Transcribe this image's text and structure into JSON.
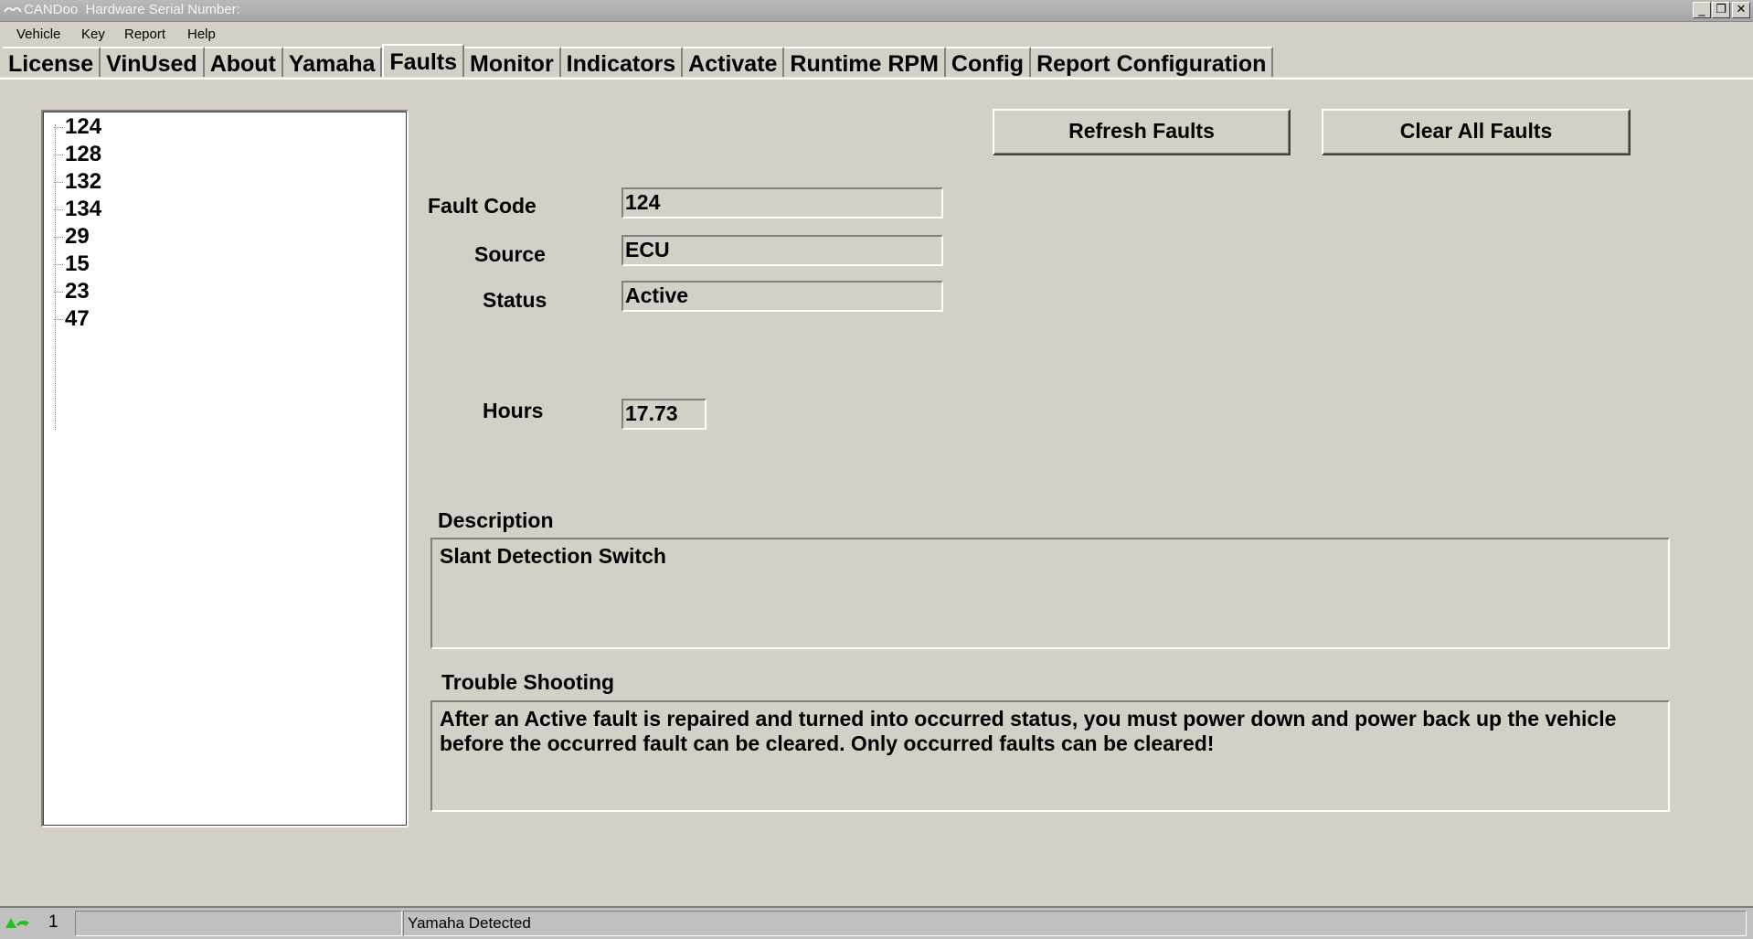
{
  "window": {
    "title": "CANDoo  Hardware Serial Number:",
    "minimize_glyph": "_",
    "restore_glyph": "❐",
    "close_glyph": "✕"
  },
  "menu": [
    "Vehicle",
    "Key",
    "Report",
    "Help"
  ],
  "tabs": [
    {
      "label": "License",
      "active": false
    },
    {
      "label": "VinUsed",
      "active": false
    },
    {
      "label": "About",
      "active": false
    },
    {
      "label": "Yamaha",
      "active": false
    },
    {
      "label": "Faults",
      "active": true
    },
    {
      "label": "Monitor",
      "active": false
    },
    {
      "label": "Indicators",
      "active": false
    },
    {
      "label": "Activate",
      "active": false
    },
    {
      "label": "Runtime RPM",
      "active": false
    },
    {
      "label": "Config",
      "active": false
    },
    {
      "label": "Report Configuration",
      "active": false
    }
  ],
  "fault_list": [
    "124",
    "128",
    "132",
    "134",
    "29",
    "15",
    "23",
    "47"
  ],
  "buttons": {
    "refresh": "Refresh Faults",
    "clear_all": "Clear All Faults"
  },
  "details": {
    "fault_code_label": "Fault Code",
    "fault_code": "124",
    "source_label": "Source",
    "source": "ECU",
    "status_label": "Status",
    "status": "Active",
    "hours_label": "Hours",
    "hours": "17.73",
    "description_label": "Description",
    "description": "Slant Detection Switch",
    "troubleshooting_label": "Trouble Shooting",
    "troubleshooting": "After an Active fault is repaired and turned into occurred status, you must power down and power back up the vehicle before the occurred fault can be cleared. Only occurred faults can be cleared!"
  },
  "statusbar": {
    "count": "1",
    "message": "Yamaha Detected"
  },
  "colors": {
    "face": "#d4d0c8",
    "status_icon": "#22c020"
  }
}
